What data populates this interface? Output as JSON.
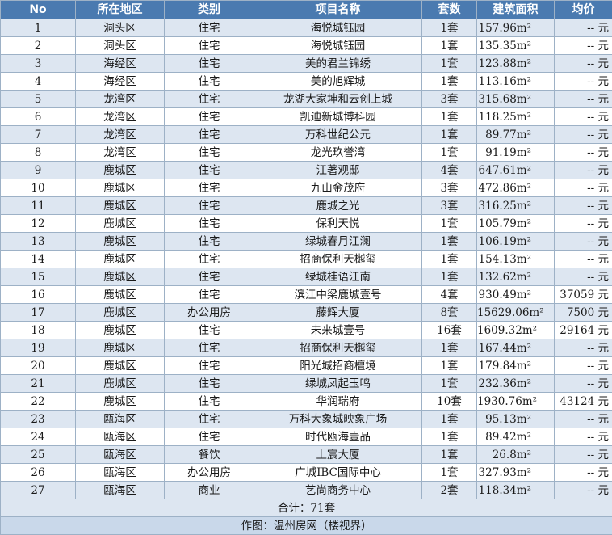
{
  "columns": [
    "No",
    "所在地区",
    "类别",
    "项目名称",
    "套数",
    "建筑面积",
    "均价"
  ],
  "rows": [
    {
      "no": "1",
      "district": "洞头区",
      "category": "住宅",
      "project": "海悦城钰园",
      "units": "1套",
      "area": "157.96m²",
      "price": "-- 元"
    },
    {
      "no": "2",
      "district": "洞头区",
      "category": "住宅",
      "project": "海悦城钰园",
      "units": "1套",
      "area": "135.35m²",
      "price": "-- 元"
    },
    {
      "no": "3",
      "district": "海经区",
      "category": "住宅",
      "project": "美的君兰锦绣",
      "units": "1套",
      "area": "123.88m²",
      "price": "-- 元"
    },
    {
      "no": "4",
      "district": "海经区",
      "category": "住宅",
      "project": "美的旭辉城",
      "units": "1套",
      "area": "113.16m²",
      "price": "-- 元"
    },
    {
      "no": "5",
      "district": "龙湾区",
      "category": "住宅",
      "project": "龙湖大家坤和云创上城",
      "units": "3套",
      "area": "315.68m²",
      "price": "-- 元"
    },
    {
      "no": "6",
      "district": "龙湾区",
      "category": "住宅",
      "project": "凯迪新城博科园",
      "units": "1套",
      "area": "118.25m²",
      "price": "-- 元"
    },
    {
      "no": "7",
      "district": "龙湾区",
      "category": "住宅",
      "project": "万科世纪公元",
      "units": "1套",
      "area": "89.77m²",
      "price": "-- 元"
    },
    {
      "no": "8",
      "district": "龙湾区",
      "category": "住宅",
      "project": "龙光玖誉湾",
      "units": "1套",
      "area": "91.19m²",
      "price": "-- 元"
    },
    {
      "no": "9",
      "district": "鹿城区",
      "category": "住宅",
      "project": "江著观邸",
      "units": "4套",
      "area": "647.61m²",
      "price": "-- 元"
    },
    {
      "no": "10",
      "district": "鹿城区",
      "category": "住宅",
      "project": "九山金茂府",
      "units": "3套",
      "area": "472.86m²",
      "price": "-- 元"
    },
    {
      "no": "11",
      "district": "鹿城区",
      "category": "住宅",
      "project": "鹿城之光",
      "units": "3套",
      "area": "316.25m²",
      "price": "-- 元"
    },
    {
      "no": "12",
      "district": "鹿城区",
      "category": "住宅",
      "project": "保利天悦",
      "units": "1套",
      "area": "105.79m²",
      "price": "-- 元"
    },
    {
      "no": "13",
      "district": "鹿城区",
      "category": "住宅",
      "project": "绿城春月江澜",
      "units": "1套",
      "area": "106.19m²",
      "price": "-- 元"
    },
    {
      "no": "14",
      "district": "鹿城区",
      "category": "住宅",
      "project": "招商保利天樾玺",
      "units": "1套",
      "area": "154.13m²",
      "price": "-- 元"
    },
    {
      "no": "15",
      "district": "鹿城区",
      "category": "住宅",
      "project": "绿城桂语江南",
      "units": "1套",
      "area": "132.62m²",
      "price": "-- 元"
    },
    {
      "no": "16",
      "district": "鹿城区",
      "category": "住宅",
      "project": "滨江中梁鹿城壹号",
      "units": "4套",
      "area": "930.49m²",
      "price": "37059 元"
    },
    {
      "no": "17",
      "district": "鹿城区",
      "category": "办公用房",
      "project": "藤辉大厦",
      "units": "8套",
      "area": "15629.06m²",
      "price": "7500 元"
    },
    {
      "no": "18",
      "district": "鹿城区",
      "category": "住宅",
      "project": "未来城壹号",
      "units": "16套",
      "area": "1609.32m²",
      "price": "29164 元"
    },
    {
      "no": "19",
      "district": "鹿城区",
      "category": "住宅",
      "project": "招商保利天樾玺",
      "units": "1套",
      "area": "167.44m²",
      "price": "-- 元"
    },
    {
      "no": "20",
      "district": "鹿城区",
      "category": "住宅",
      "project": "阳光城招商檀境",
      "units": "1套",
      "area": "179.84m²",
      "price": "-- 元"
    },
    {
      "no": "21",
      "district": "鹿城区",
      "category": "住宅",
      "project": "绿城凤起玉鸣",
      "units": "1套",
      "area": "232.36m²",
      "price": "-- 元"
    },
    {
      "no": "22",
      "district": "鹿城区",
      "category": "住宅",
      "project": "华润瑞府",
      "units": "10套",
      "area": "1930.76m²",
      "price": "43124 元"
    },
    {
      "no": "23",
      "district": "瓯海区",
      "category": "住宅",
      "project": "万科大象城映象广场",
      "units": "1套",
      "area": "95.13m²",
      "price": "-- 元"
    },
    {
      "no": "24",
      "district": "瓯海区",
      "category": "住宅",
      "project": "时代瓯海壹品",
      "units": "1套",
      "area": "89.42m²",
      "price": "-- 元"
    },
    {
      "no": "25",
      "district": "瓯海区",
      "category": "餐饮",
      "project": "上宸大厦",
      "units": "1套",
      "area": "26.8m²",
      "price": "-- 元"
    },
    {
      "no": "26",
      "district": "瓯海区",
      "category": "办公用房",
      "project": "广城IBC国际中心",
      "units": "1套",
      "area": "327.93m²",
      "price": "-- 元"
    },
    {
      "no": "27",
      "district": "瓯海区",
      "category": "商业",
      "project": "艺尚商务中心",
      "units": "2套",
      "area": "118.34m²",
      "price": "-- 元"
    }
  ],
  "footer": {
    "total": "合计：71套",
    "source": "作图：温州房网（楼视界）"
  }
}
